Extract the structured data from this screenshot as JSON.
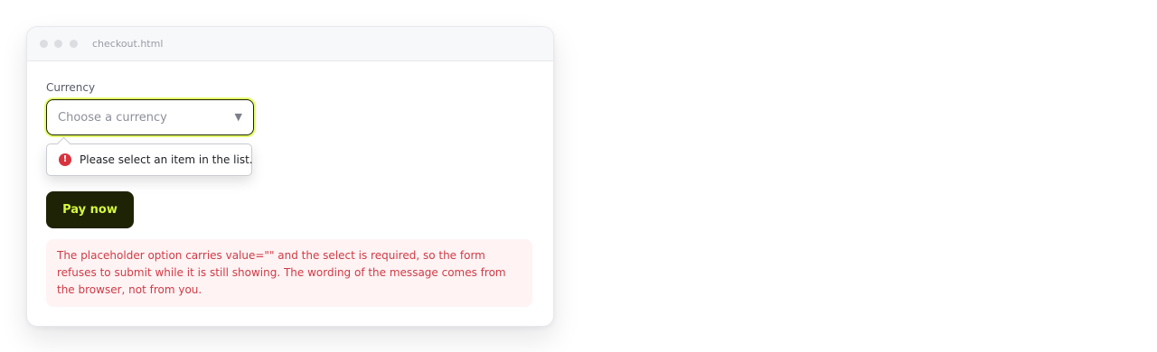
{
  "window": {
    "tab_title": "checkout.html"
  },
  "form": {
    "currency_label": "Currency",
    "select_placeholder": "Choose a currency",
    "select_arrow_icon": "triangle-down",
    "validation_message": "Please select an item in the list.",
    "validation_icon": "exclamation-circle",
    "pay_button_label": "Pay now"
  },
  "note": {
    "text": "The placeholder option carries value=\"\" and the select is required, so the form refuses to submit while it is still showing. The wording of the message comes from the browser, not from you."
  },
  "colors": {
    "button_bg": "#1f2305",
    "button_text": "#d5f83f",
    "focus_ring": "#e4ff6a",
    "error_icon": "#d8343f",
    "note_bg": "#fff3f4",
    "note_text": "#cf3b45"
  }
}
